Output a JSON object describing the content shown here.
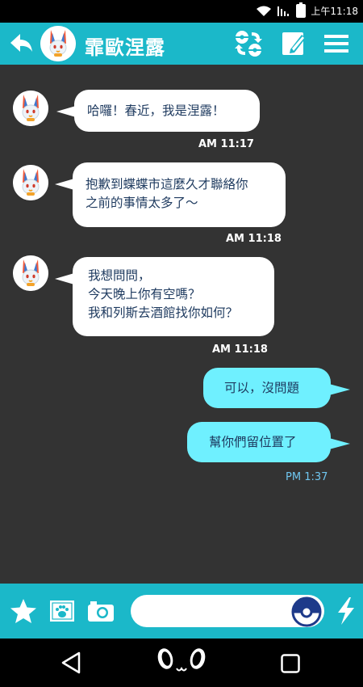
{
  "status_bar": {
    "time": "上午11:18"
  },
  "header": {
    "title": "霏歐涅露"
  },
  "messages": [
    {
      "direction": "in",
      "text": "哈囉！春近，我是涅露！",
      "time": "AM 11:17"
    },
    {
      "direction": "in",
      "text": "抱歉到蝶蝶市這麼久才聯絡你\n之前的事情太多了～",
      "time": "AM 11:18"
    },
    {
      "direction": "in",
      "text": "我想問問，\n今天晚上你有空嗎？\n我和列斯去酒館找你如何？",
      "time": "AM 11:18"
    },
    {
      "direction": "out",
      "text": "可以，沒問題",
      "time": ""
    },
    {
      "direction": "out",
      "text": "幫你們留位置了",
      "time": "PM 1:37"
    }
  ],
  "input": {
    "value": "",
    "placeholder": ""
  },
  "colors": {
    "accent": "#1bb8c9",
    "chat_bg": "#333333",
    "outgoing_bubble": "#6ff0ff",
    "bubble_text": "#1e3a5f"
  }
}
